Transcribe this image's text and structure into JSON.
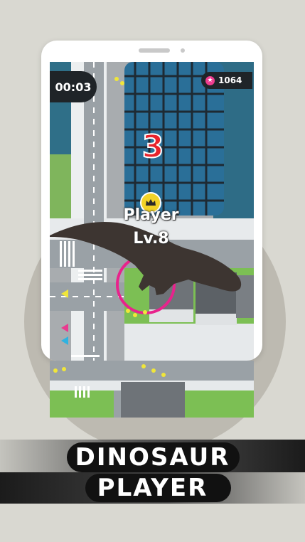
{
  "hud": {
    "timer": "00:03",
    "score": "1064",
    "score_icon": "star-icon",
    "countdown": "3"
  },
  "player": {
    "name": "Player",
    "level": "Lv.8",
    "badge_icon": "crown-icon"
  },
  "banner": {
    "line1": "DINOSAUR",
    "line2": "PLAYER"
  },
  "colors": {
    "background": "#d9d8d1",
    "circle": "#bdbab1",
    "countdown": "#e8232c",
    "score_star": "#ee3d8f",
    "ring": "#e8238c",
    "crown": "#f2d327"
  }
}
